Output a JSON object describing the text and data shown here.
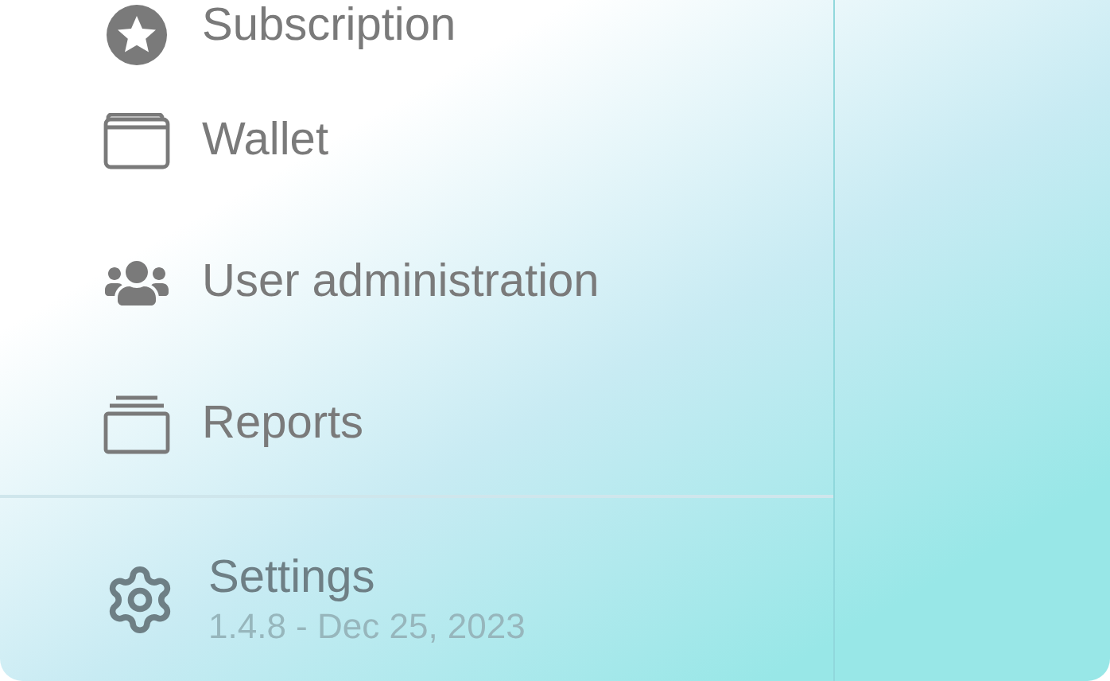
{
  "sidebar": {
    "items": [
      {
        "label": "Subscription"
      },
      {
        "label": "Wallet"
      },
      {
        "label": "User administration"
      },
      {
        "label": "Reports"
      }
    ],
    "footer": {
      "label": "Settings",
      "version": "1.4.8 - Dec 25, 2023"
    }
  }
}
